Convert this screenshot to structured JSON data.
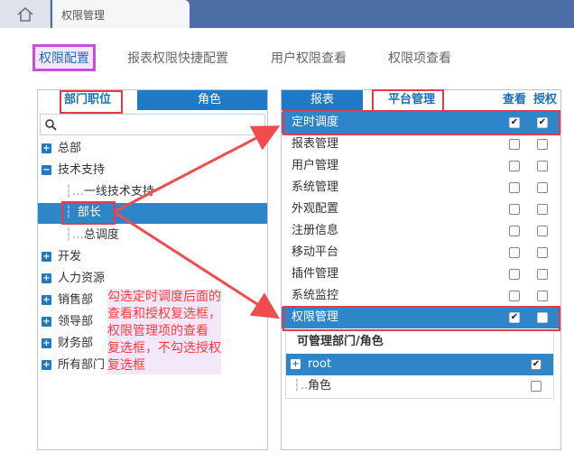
{
  "topbar": {
    "home_icon": "home-icon",
    "page_tab": "权限管理"
  },
  "main_tabs": [
    "权限配置",
    "报表权限快捷配置",
    "用户权限查看",
    "权限项查看"
  ],
  "left_panel": {
    "tabs": [
      "部门职位",
      "角色"
    ],
    "search_icon": "search-icon",
    "tree": [
      "总部",
      "技术支持",
      "一线技术支持",
      "部长",
      "总调度",
      "开发",
      "人力资源",
      "销售部",
      "领导部",
      "财务部",
      "所有部门"
    ],
    "expand_symbol": "+",
    "collapse_symbol": "−"
  },
  "right_panel": {
    "tabs": [
      "报表",
      "平台管理"
    ],
    "col_view": "查看",
    "col_auth": "授权",
    "rows": [
      "定时调度",
      "报表管理",
      "用户管理",
      "系统管理",
      "外观配置",
      "注册信息",
      "移动平台",
      "插件管理",
      "系统监控",
      "权限管理"
    ],
    "checked_view": [
      true,
      false,
      false,
      false,
      false,
      false,
      false,
      false,
      false,
      true
    ],
    "checked_auth": [
      true,
      false,
      false,
      false,
      false,
      false,
      false,
      false,
      false,
      false
    ],
    "sub_header": "可管理部门/角色",
    "sub_rows": [
      "root",
      "角色"
    ],
    "sub_checked": [
      true,
      false
    ]
  },
  "annotation": "勾选定时调度后面的\n查看和授权复选框，\n权限管理项的查看\n复选框，不勾选授权\n复选框",
  "colors": {
    "accent": "#1f79c7",
    "selected_row": "#2e86c8",
    "highlight_border": "#e8394a",
    "tab_outline": "#c84ee0",
    "topbar": "#4b6ea6"
  }
}
